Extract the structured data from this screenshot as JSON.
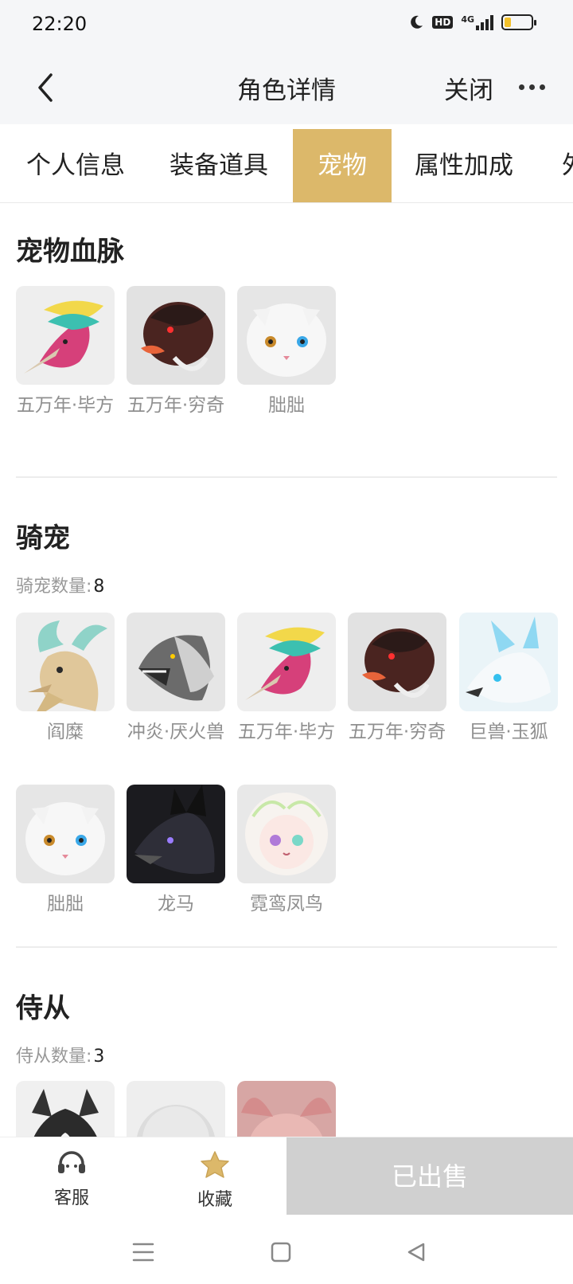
{
  "status": {
    "time": "22:20",
    "network": "4G",
    "hd_label": "HD",
    "battery_level": 0.25
  },
  "nav": {
    "title": "角色详情",
    "close": "关闭"
  },
  "tabs": [
    {
      "label": "个人信息"
    },
    {
      "label": "装备道具"
    },
    {
      "label": "宠物",
      "active": true
    },
    {
      "label": "属性加成"
    },
    {
      "label": "外"
    }
  ],
  "bloodline": {
    "title": "宠物血脉",
    "pets": [
      {
        "name": "五万年·毕方",
        "icon": "bifang-avatar"
      },
      {
        "name": "五万年·穷奇",
        "icon": "qiongqi-avatar"
      },
      {
        "name": "朏朏",
        "icon": "feifei-cat-avatar"
      }
    ]
  },
  "mounts": {
    "title": "骑宠",
    "count_label": "骑宠数量:",
    "count": "8",
    "pets": [
      {
        "name": "阎糜",
        "icon": "deer-avatar"
      },
      {
        "name": "冲炎·厌火兽",
        "icon": "wolf-avatar"
      },
      {
        "name": "五万年·毕方",
        "icon": "bifang-avatar"
      },
      {
        "name": "五万年·穷奇",
        "icon": "qiongqi-avatar"
      },
      {
        "name": "巨兽·玉狐",
        "icon": "fox-avatar"
      },
      {
        "name": "朏朏",
        "icon": "feifei-cat-avatar"
      },
      {
        "name": "龙马",
        "icon": "dragon-horse-avatar"
      },
      {
        "name": "霓鸾凤鸟",
        "icon": "phoenix-avatar"
      }
    ]
  },
  "attendants": {
    "title": "侍从",
    "count_label": "侍从数量:",
    "count": "3",
    "pets": [
      {
        "icon": "husky-avatar"
      },
      {
        "icon": "snowball-avatar"
      },
      {
        "icon": "pig-avatar"
      }
    ]
  },
  "bottom": {
    "service": "客服",
    "favorite": "收藏",
    "sold": "已出售"
  },
  "colors": {
    "accent": "#dcb86a",
    "sold_bg": "#d0d0d0",
    "muted_text": "#8f8f8f"
  }
}
